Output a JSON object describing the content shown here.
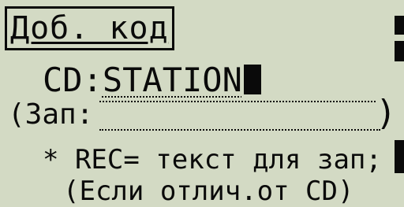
{
  "screen": {
    "title": "Доб. код",
    "cd_label": "CD:",
    "cd_value": "STATION",
    "rec_label": "(Зап:",
    "rec_close": ")",
    "note_line1": "* REC= текст для зап;",
    "note_line2": "(Если отлич.от CD)"
  }
}
